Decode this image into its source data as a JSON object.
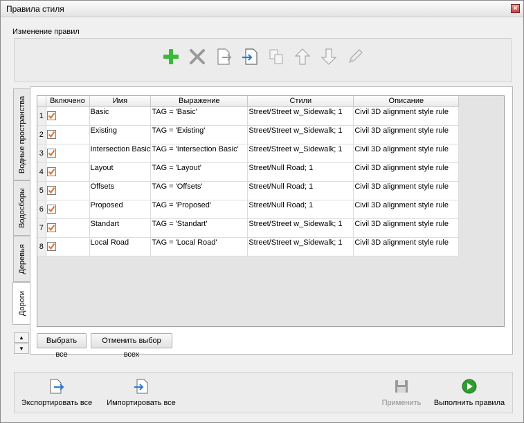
{
  "window": {
    "title": "Правила стиля",
    "close_glyph": "×"
  },
  "group_label": "Изменение правил",
  "toolbar_icons": [
    "add-icon",
    "delete-icon",
    "export-icon",
    "import-icon",
    "copy-icon",
    "arrow-up-icon",
    "arrow-down-icon",
    "pencil-icon"
  ],
  "tabs": [
    {
      "label": "Водные пространства",
      "active": false
    },
    {
      "label": "Водосборы",
      "active": false
    },
    {
      "label": "Деревья",
      "active": false
    },
    {
      "label": "Дороги",
      "active": true
    }
  ],
  "scroll_up": "▲",
  "scroll_down": "▼",
  "table": {
    "headers": [
      "Включено",
      "Имя",
      "Выражение",
      "Стили",
      "Описание"
    ],
    "rows": [
      {
        "num": "1",
        "enabled": true,
        "name": "Basic",
        "expr": "TAG = 'Basic'",
        "style": "Street/Street w_Sidewalk; 1",
        "desc": "Civil 3D alignment style rule"
      },
      {
        "num": "2",
        "enabled": true,
        "name": "Existing",
        "expr": "TAG = 'Existing'",
        "style": "Street/Street w_Sidewalk; 1",
        "desc": "Civil 3D alignment style rule"
      },
      {
        "num": "3",
        "enabled": true,
        "name": "Intersection Basic",
        "expr": "TAG = 'Intersection Basic'",
        "style": "Street/Street w_Sidewalk; 1",
        "desc": "Civil 3D alignment style rule"
      },
      {
        "num": "4",
        "enabled": true,
        "name": "Layout",
        "expr": "TAG = 'Layout'",
        "style": "Street/Null Road; 1",
        "desc": "Civil 3D alignment style rule"
      },
      {
        "num": "5",
        "enabled": true,
        "name": "Offsets",
        "expr": "TAG = 'Offsets'",
        "style": "Street/Null Road; 1",
        "desc": "Civil 3D alignment style rule"
      },
      {
        "num": "6",
        "enabled": true,
        "name": "Proposed",
        "expr": "TAG = 'Proposed'",
        "style": "Street/Null Road; 1",
        "desc": "Civil 3D alignment style rule"
      },
      {
        "num": "7",
        "enabled": true,
        "name": "Standart",
        "expr": "TAG = 'Standart'",
        "style": "Street/Street w_Sidewalk; 1",
        "desc": "Civil 3D alignment style rule"
      },
      {
        "num": "8",
        "enabled": true,
        "name": "Local Road",
        "expr": "TAG = 'Local Road'",
        "style": "Street/Street w_Sidewalk; 1",
        "desc": "Civil 3D alignment style rule"
      }
    ]
  },
  "buttons": {
    "select_all": "Выбрать все",
    "deselect_all": "Отменить выбор всех"
  },
  "bottom": {
    "export_all": "Экспортировать все",
    "import_all": "Импортировать все",
    "apply": "Применить",
    "run_rules": "Выполнить правила"
  },
  "colors": {
    "checkbox_mark": "#e8742a",
    "add_green": "#3cb93c",
    "run_green": "#2e9e2e",
    "arrow_blue": "#2a78d8"
  }
}
